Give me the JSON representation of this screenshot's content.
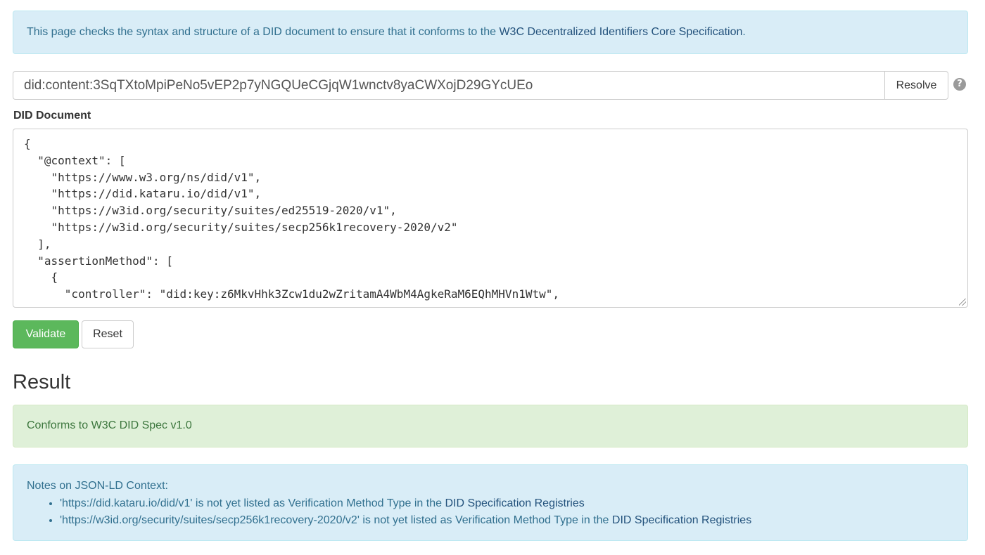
{
  "intro": {
    "text": "This page checks the syntax and structure of a DID document to ensure that it conforms to the ",
    "link": "W3C Decentralized Identifiers Core Specification",
    "suffix": "."
  },
  "resolver": {
    "value": "did:content:3SqTXtoMpiPeNo5vEP2p7yNGQUeCGjqW1wnctv8yaCWXojD29GYcUEo",
    "button_label": "Resolve",
    "help_icon": "question-circle-icon"
  },
  "document": {
    "label": "DID Document",
    "content": "{\n  \"@context\": [\n    \"https://www.w3.org/ns/did/v1\",\n    \"https://did.kataru.io/did/v1\",\n    \"https://w3id.org/security/suites/ed25519-2020/v1\",\n    \"https://w3id.org/security/suites/secp256k1recovery-2020/v2\"\n  ],\n  \"assertionMethod\": [\n    {\n      \"controller\": \"did:key:z6MkvHhk3Zcw1du2wZritamA4WbM4AgkeRaM6EQhMHVn1Wtw\","
  },
  "actions": {
    "validate_label": "Validate",
    "reset_label": "Reset"
  },
  "result": {
    "heading": "Result",
    "status": "Conforms to W3C DID Spec v1.0"
  },
  "notes": {
    "title": "Notes on JSON-LD Context:",
    "items": [
      {
        "text": "'https://did.kataru.io/did/v1' is not yet listed as Verification Method Type in the ",
        "link": "DID Specification Registries"
      },
      {
        "text": "'https://w3id.org/security/suites/secp256k1recovery-2020/v2' is not yet listed as Verification Method Type in the ",
        "link": "DID Specification Registries"
      }
    ]
  },
  "colors": {
    "info_bg": "#d9edf7",
    "info_text": "#31708f",
    "success_bg": "#dff0d8",
    "success_text": "#3c763d",
    "validate_button": "#5cb85c"
  }
}
